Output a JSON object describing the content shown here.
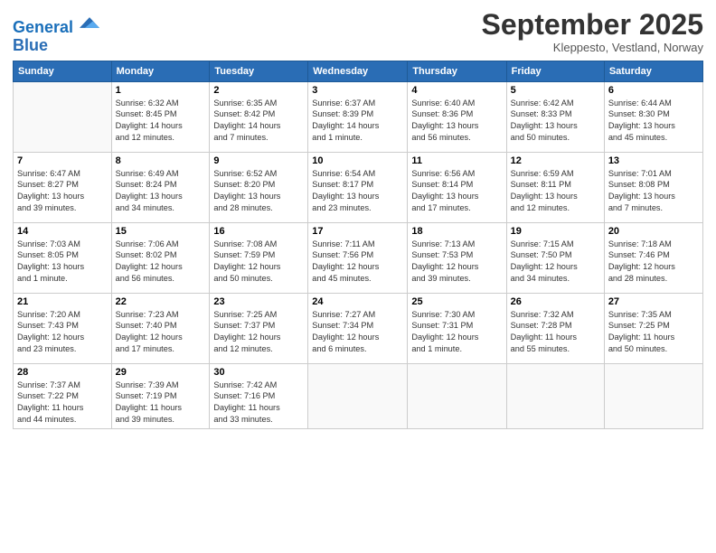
{
  "header": {
    "logo_line1": "General",
    "logo_line2": "Blue",
    "month": "September 2025",
    "location": "Kleppesto, Vestland, Norway"
  },
  "days_of_week": [
    "Sunday",
    "Monday",
    "Tuesday",
    "Wednesday",
    "Thursday",
    "Friday",
    "Saturday"
  ],
  "weeks": [
    [
      {
        "day": "",
        "info": ""
      },
      {
        "day": "1",
        "info": "Sunrise: 6:32 AM\nSunset: 8:45 PM\nDaylight: 14 hours\nand 12 minutes."
      },
      {
        "day": "2",
        "info": "Sunrise: 6:35 AM\nSunset: 8:42 PM\nDaylight: 14 hours\nand 7 minutes."
      },
      {
        "day": "3",
        "info": "Sunrise: 6:37 AM\nSunset: 8:39 PM\nDaylight: 14 hours\nand 1 minute."
      },
      {
        "day": "4",
        "info": "Sunrise: 6:40 AM\nSunset: 8:36 PM\nDaylight: 13 hours\nand 56 minutes."
      },
      {
        "day": "5",
        "info": "Sunrise: 6:42 AM\nSunset: 8:33 PM\nDaylight: 13 hours\nand 50 minutes."
      },
      {
        "day": "6",
        "info": "Sunrise: 6:44 AM\nSunset: 8:30 PM\nDaylight: 13 hours\nand 45 minutes."
      }
    ],
    [
      {
        "day": "7",
        "info": "Sunrise: 6:47 AM\nSunset: 8:27 PM\nDaylight: 13 hours\nand 39 minutes."
      },
      {
        "day": "8",
        "info": "Sunrise: 6:49 AM\nSunset: 8:24 PM\nDaylight: 13 hours\nand 34 minutes."
      },
      {
        "day": "9",
        "info": "Sunrise: 6:52 AM\nSunset: 8:20 PM\nDaylight: 13 hours\nand 28 minutes."
      },
      {
        "day": "10",
        "info": "Sunrise: 6:54 AM\nSunset: 8:17 PM\nDaylight: 13 hours\nand 23 minutes."
      },
      {
        "day": "11",
        "info": "Sunrise: 6:56 AM\nSunset: 8:14 PM\nDaylight: 13 hours\nand 17 minutes."
      },
      {
        "day": "12",
        "info": "Sunrise: 6:59 AM\nSunset: 8:11 PM\nDaylight: 13 hours\nand 12 minutes."
      },
      {
        "day": "13",
        "info": "Sunrise: 7:01 AM\nSunset: 8:08 PM\nDaylight: 13 hours\nand 7 minutes."
      }
    ],
    [
      {
        "day": "14",
        "info": "Sunrise: 7:03 AM\nSunset: 8:05 PM\nDaylight: 13 hours\nand 1 minute."
      },
      {
        "day": "15",
        "info": "Sunrise: 7:06 AM\nSunset: 8:02 PM\nDaylight: 12 hours\nand 56 minutes."
      },
      {
        "day": "16",
        "info": "Sunrise: 7:08 AM\nSunset: 7:59 PM\nDaylight: 12 hours\nand 50 minutes."
      },
      {
        "day": "17",
        "info": "Sunrise: 7:11 AM\nSunset: 7:56 PM\nDaylight: 12 hours\nand 45 minutes."
      },
      {
        "day": "18",
        "info": "Sunrise: 7:13 AM\nSunset: 7:53 PM\nDaylight: 12 hours\nand 39 minutes."
      },
      {
        "day": "19",
        "info": "Sunrise: 7:15 AM\nSunset: 7:50 PM\nDaylight: 12 hours\nand 34 minutes."
      },
      {
        "day": "20",
        "info": "Sunrise: 7:18 AM\nSunset: 7:46 PM\nDaylight: 12 hours\nand 28 minutes."
      }
    ],
    [
      {
        "day": "21",
        "info": "Sunrise: 7:20 AM\nSunset: 7:43 PM\nDaylight: 12 hours\nand 23 minutes."
      },
      {
        "day": "22",
        "info": "Sunrise: 7:23 AM\nSunset: 7:40 PM\nDaylight: 12 hours\nand 17 minutes."
      },
      {
        "day": "23",
        "info": "Sunrise: 7:25 AM\nSunset: 7:37 PM\nDaylight: 12 hours\nand 12 minutes."
      },
      {
        "day": "24",
        "info": "Sunrise: 7:27 AM\nSunset: 7:34 PM\nDaylight: 12 hours\nand 6 minutes."
      },
      {
        "day": "25",
        "info": "Sunrise: 7:30 AM\nSunset: 7:31 PM\nDaylight: 12 hours\nand 1 minute."
      },
      {
        "day": "26",
        "info": "Sunrise: 7:32 AM\nSunset: 7:28 PM\nDaylight: 11 hours\nand 55 minutes."
      },
      {
        "day": "27",
        "info": "Sunrise: 7:35 AM\nSunset: 7:25 PM\nDaylight: 11 hours\nand 50 minutes."
      }
    ],
    [
      {
        "day": "28",
        "info": "Sunrise: 7:37 AM\nSunset: 7:22 PM\nDaylight: 11 hours\nand 44 minutes."
      },
      {
        "day": "29",
        "info": "Sunrise: 7:39 AM\nSunset: 7:19 PM\nDaylight: 11 hours\nand 39 minutes."
      },
      {
        "day": "30",
        "info": "Sunrise: 7:42 AM\nSunset: 7:16 PM\nDaylight: 11 hours\nand 33 minutes."
      },
      {
        "day": "",
        "info": ""
      },
      {
        "day": "",
        "info": ""
      },
      {
        "day": "",
        "info": ""
      },
      {
        "day": "",
        "info": ""
      }
    ]
  ]
}
